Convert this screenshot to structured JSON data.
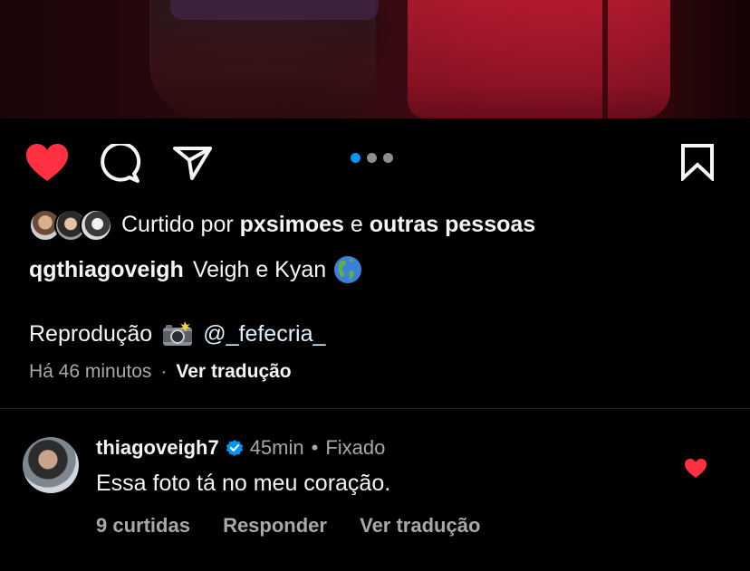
{
  "post": {
    "likes": {
      "prefix": "Curtido por",
      "user": "pxsimoes",
      "connector": "e",
      "others": "outras pessoas"
    },
    "caption": {
      "username": "qgthiagoveigh",
      "text": "Veigh e Kyan",
      "emoji": "globe-americas-icon",
      "credit_label": "Reprodução",
      "credit_emoji": "camera-flash-icon",
      "credit_mention": "@_fefecria_"
    },
    "meta": {
      "time": "Há 46 minutos",
      "separator": "·",
      "translate": "Ver tradução"
    },
    "carousel": {
      "count": 3,
      "active": 0
    },
    "liked": true
  },
  "comment": {
    "username": "thiagoveigh7",
    "verified": true,
    "time": "45min",
    "separator": "•",
    "pinned": "Fixado",
    "text": "Essa foto tá no meu coração.",
    "likes": "9 curtidas",
    "reply": "Responder",
    "translate": "Ver tradução",
    "liked": true
  },
  "colors": {
    "like_red": "#ff3040",
    "active_dot": "#0095f6",
    "verified_blue": "#0095f6",
    "muted_text": "#a8a8a8"
  }
}
